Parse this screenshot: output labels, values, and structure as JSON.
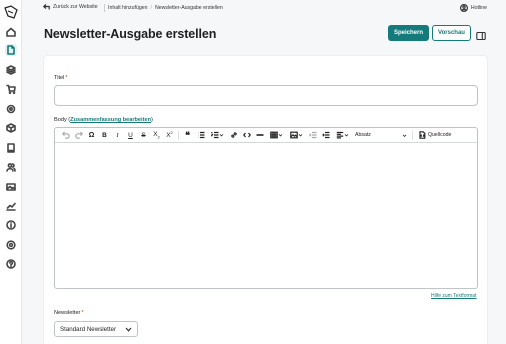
{
  "topbar": {
    "back_label": "Zurück zur Website",
    "breadcrumbs": [
      "Inhalt hinzufügen",
      "Newsletter-Ausgabe erstellen"
    ],
    "hotline_label": "Hotline"
  },
  "page": {
    "title": "Newsletter-Ausgabe erstellen",
    "save_label": "Speichern",
    "preview_label": "Vorschau"
  },
  "sidebar": {
    "items": [
      {
        "icon": "home-icon"
      },
      {
        "icon": "document-icon",
        "active": true
      },
      {
        "icon": "layers-icon"
      },
      {
        "icon": "cart-icon"
      },
      {
        "icon": "gear-icon"
      },
      {
        "icon": "box-icon"
      },
      {
        "icon": "book-icon"
      },
      {
        "icon": "users-icon"
      },
      {
        "icon": "image-icon"
      },
      {
        "icon": "chart-icon"
      },
      {
        "icon": "info-icon"
      },
      {
        "icon": "settings-icon"
      },
      {
        "icon": "help-icon"
      }
    ]
  },
  "form": {
    "title_label": "Titel",
    "required_mark": "*",
    "body_label_prefix": "Body (",
    "body_label_link": "Zusammenfassung bearbeiten",
    "body_label_suffix": ")",
    "editor": {
      "format_label": "Absatz",
      "source_label": "Quellcode"
    },
    "help_link": "Hilfe zum Textformat",
    "newsletter_label": "Newsletter",
    "newsletter_value": "Standard Newsletter"
  },
  "colors": {
    "accent": "#157a7a"
  }
}
